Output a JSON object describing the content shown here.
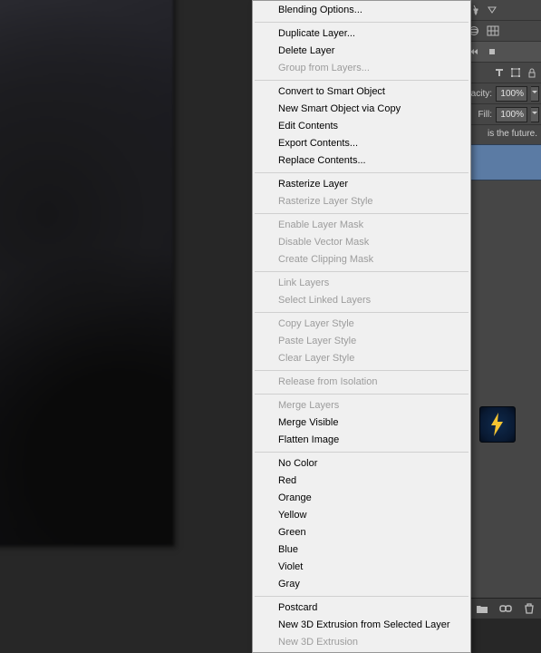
{
  "panel": {
    "opacity_label": "pacity:",
    "opacity_value": "100%",
    "fill_label": "Fill:",
    "fill_value": "100%",
    "hint_text": "is the future."
  },
  "menu": {
    "blending_options": "Blending Options...",
    "duplicate_layer": "Duplicate Layer...",
    "delete_layer": "Delete Layer",
    "group_from_layers": "Group from Layers...",
    "convert_smart_object": "Convert to Smart Object",
    "new_smart_object_copy": "New Smart Object via Copy",
    "edit_contents": "Edit Contents",
    "export_contents": "Export Contents...",
    "replace_contents": "Replace Contents...",
    "rasterize_layer": "Rasterize Layer",
    "rasterize_layer_style": "Rasterize Layer Style",
    "enable_layer_mask": "Enable Layer Mask",
    "disable_vector_mask": "Disable Vector Mask",
    "create_clipping_mask": "Create Clipping Mask",
    "link_layers": "Link Layers",
    "select_linked_layers": "Select Linked Layers",
    "copy_layer_style": "Copy Layer Style",
    "paste_layer_style": "Paste Layer Style",
    "clear_layer_style": "Clear Layer Style",
    "release_from_isolation": "Release from Isolation",
    "merge_layers": "Merge Layers",
    "merge_visible": "Merge Visible",
    "flatten_image": "Flatten Image",
    "no_color": "No Color",
    "red": "Red",
    "orange": "Orange",
    "yellow": "Yellow",
    "green": "Green",
    "blue": "Blue",
    "violet": "Violet",
    "gray": "Gray",
    "postcard": "Postcard",
    "new_3d_extrusion_layer": "New 3D Extrusion from Selected Layer",
    "new_3d_extrusion": "New 3D Extrusion"
  },
  "icons": {
    "pin": "pin-icon",
    "triangle": "triangle-down-icon",
    "sphere": "sphere-icon",
    "grid": "grid-icon",
    "prev": "rewind-icon",
    "square": "square-icon",
    "type": "type-icon",
    "transform": "transform-icon",
    "lock": "lock-icon",
    "bolt": "lightning-bolt-icon",
    "folder": "folder-icon",
    "link": "chain-link-icon",
    "trash": "trash-icon"
  }
}
